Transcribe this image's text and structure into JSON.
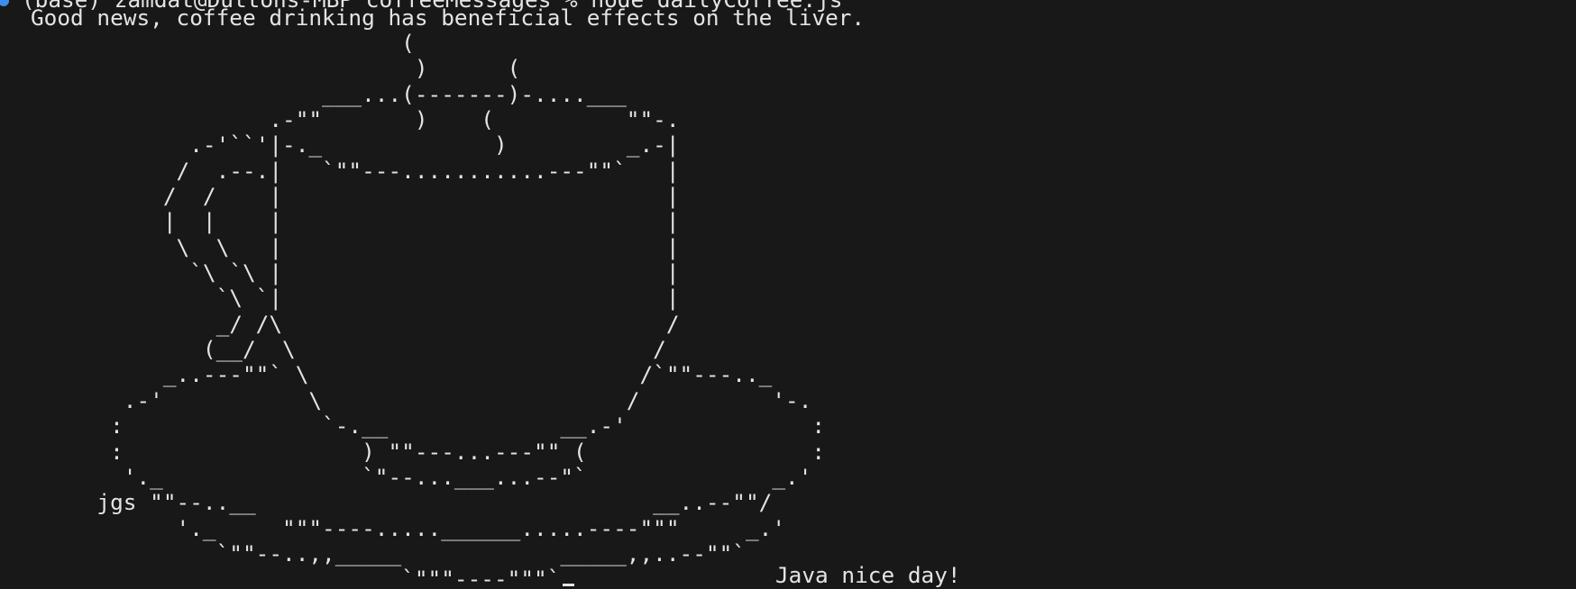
{
  "terminal": {
    "prompt": {
      "text": "(base) zamdat@Duttons-MBP coffeeMessages % node dailyCoffee.js",
      "status_color": "#3b8eea"
    },
    "message": "Good news, coffee drinking has beneficial effects on the liver.",
    "ascii_art": "                            (\n                             )      (\n                      ___...(-------)-....___\n                  .-\"\"       )    (          \"\"-.\n            .-'``'|-._             )         _.-|\n           /  .--.|   `\"\"---...........---\"\"`   |\n          /  /    |                             |\n          |  |    |                             |\n           \\  \\   |                             |\n            `\\ `\\ |                             |\n              `\\ `|                             |\n              _/ /\\                             /\n             (__/  \\                           /\n          _..---\"\"` \\                         /`\"\"---.._\n       .-'           \\                       /          '-.\n      :               `-.__             __.-'              :\n      :                  ) \"\"---...---\"\" (                 :\n       '._               `\"--...___...--\"`              _.'\n     jgs \"\"--..__                              __..--\"\"/\n           '._     \"\"\"----.....______.....----\"\"\"     _.'\n              `\"\"--..,,_____            _____,,..--\"\"`\n                            `\"\"\"----\"\"\"`",
    "closing": "Java nice day!"
  }
}
